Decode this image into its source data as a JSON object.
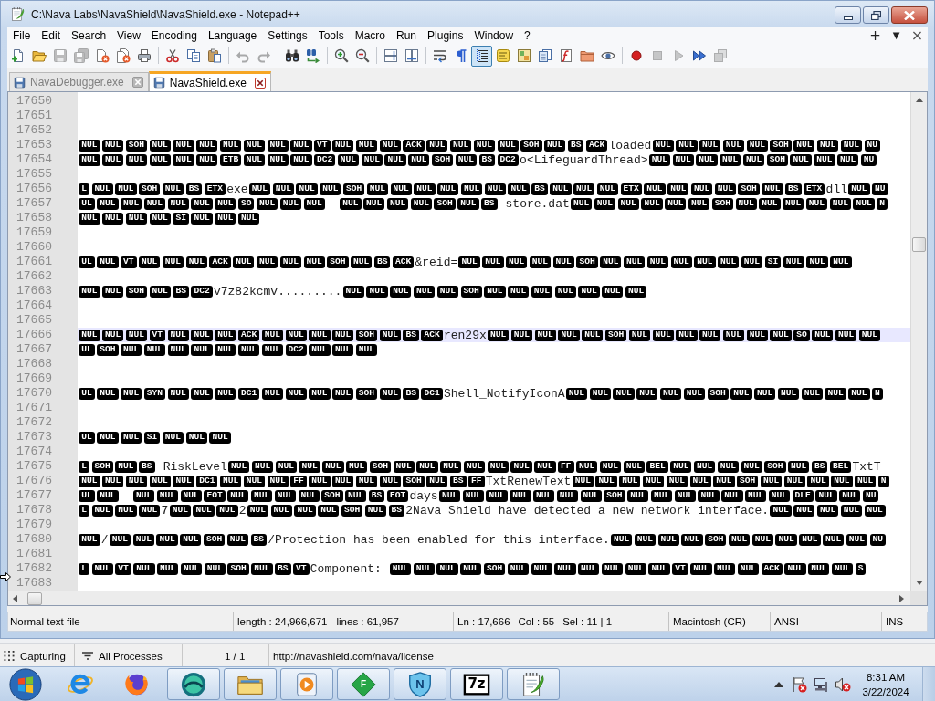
{
  "window": {
    "title": "C:\\Nava Labs\\NavaShield\\NavaShield.exe - Notepad++"
  },
  "menu": [
    "File",
    "Edit",
    "Search",
    "View",
    "Encoding",
    "Language",
    "Settings",
    "Tools",
    "Macro",
    "Run",
    "Plugins",
    "Window",
    "?"
  ],
  "menu_extras": [
    {
      "kind": "new-tab",
      "text": "+"
    },
    {
      "kind": "tab-list",
      "text": "▼"
    },
    {
      "kind": "close-tab",
      "text": "×"
    }
  ],
  "toolbar": [
    {
      "buttons": [
        {
          "kind": "new",
          "pressed": false,
          "disabled": false
        },
        {
          "kind": "open",
          "pressed": false,
          "disabled": false
        },
        {
          "kind": "save",
          "pressed": false,
          "disabled": true
        },
        {
          "kind": "save-all",
          "pressed": false,
          "disabled": true
        },
        {
          "kind": "close",
          "pressed": false,
          "disabled": false
        },
        {
          "kind": "close-all",
          "pressed": false,
          "disabled": false
        },
        {
          "kind": "print",
          "pressed": false,
          "disabled": false
        }
      ]
    },
    {
      "buttons": [
        {
          "kind": "cut",
          "pressed": false,
          "disabled": false
        },
        {
          "kind": "copy",
          "pressed": false,
          "disabled": false
        },
        {
          "kind": "paste",
          "pressed": false,
          "disabled": false
        }
      ]
    },
    {
      "buttons": [
        {
          "kind": "undo",
          "pressed": false,
          "disabled": true
        },
        {
          "kind": "redo",
          "pressed": false,
          "disabled": true
        }
      ]
    },
    {
      "buttons": [
        {
          "kind": "find",
          "pressed": false,
          "disabled": false
        },
        {
          "kind": "replace",
          "pressed": false,
          "disabled": false
        }
      ]
    },
    {
      "buttons": [
        {
          "kind": "zoom-in",
          "pressed": false,
          "disabled": false
        },
        {
          "kind": "zoom-out",
          "pressed": false,
          "disabled": false
        }
      ]
    },
    {
      "buttons": [
        {
          "kind": "sync-vertical",
          "pressed": false,
          "disabled": false
        },
        {
          "kind": "sync-horizontal",
          "pressed": false,
          "disabled": false
        }
      ]
    },
    {
      "buttons": [
        {
          "kind": "word-wrap",
          "pressed": false,
          "disabled": false
        },
        {
          "kind": "all-characters",
          "pressed": false,
          "disabled": false
        },
        {
          "kind": "indent-guide",
          "pressed": true,
          "disabled": false
        },
        {
          "kind": "language",
          "pressed": false,
          "disabled": false
        },
        {
          "kind": "document-map",
          "pressed": false,
          "disabled": false
        },
        {
          "kind": "document-list",
          "pressed": false,
          "disabled": false
        },
        {
          "kind": "function-list",
          "pressed": false,
          "disabled": false
        },
        {
          "kind": "folder-workspace",
          "pressed": false,
          "disabled": false
        },
        {
          "kind": "monitoring",
          "pressed": false,
          "disabled": false
        }
      ]
    },
    {
      "buttons": [
        {
          "kind": "record",
          "pressed": false,
          "disabled": false
        },
        {
          "kind": "stop",
          "pressed": false,
          "disabled": true
        },
        {
          "kind": "play",
          "pressed": false,
          "disabled": true
        },
        {
          "kind": "play-multiple",
          "pressed": false,
          "disabled": false
        },
        {
          "kind": "save-macro",
          "pressed": false,
          "disabled": true
        }
      ]
    }
  ],
  "tabs": [
    {
      "label": "NavaDebugger.exe",
      "selected": false
    },
    {
      "label": "NavaShield.exe",
      "selected": true
    }
  ],
  "editor": {
    "lines": [
      {
        "number": "17650",
        "current": false
      },
      {
        "number": "17651",
        "current": false
      },
      {
        "number": "17652",
        "current": false
      },
      {
        "number": "17653",
        "current": false,
        "segments": [
          {
            "kind": "ctrl",
            "codes": [
              "NUL",
              "NUL",
              "SOH",
              "NUL",
              "NUL",
              "NUL",
              "NUL",
              "NUL",
              "NUL",
              "NUL",
              "VT",
              "NUL",
              "NUL",
              "NUL",
              "ACK",
              "NUL",
              "NUL",
              "NUL",
              "NUL",
              "SOH",
              "NUL",
              "BS",
              "ACK"
            ]
          },
          {
            "kind": "text",
            "text": "loaded"
          },
          {
            "kind": "ctrl",
            "codes": [
              "NUL",
              "NUL",
              "NUL",
              "NUL",
              "NUL",
              "SOH",
              "NUL",
              "NUL",
              "NUL",
              "NU"
            ]
          }
        ]
      },
      {
        "number": "17654",
        "current": false,
        "segments": [
          {
            "kind": "ctrl",
            "codes": [
              "NUL",
              "NUL",
              "NUL",
              "NUL",
              "NUL",
              "NUL",
              "ETB",
              "NUL",
              "NUL",
              "NUL",
              "DC2",
              "NUL",
              "NUL",
              "NUL",
              "NUL",
              "SOH",
              "NUL",
              "BS",
              "DC2"
            ]
          },
          {
            "kind": "text",
            "text": "o<LifeguardThread>"
          },
          {
            "kind": "ctrl",
            "codes": [
              "NUL",
              "NUL",
              "NUL",
              "NUL",
              "NUL",
              "SOH",
              "NUL",
              "NUL",
              "NUL",
              "NU"
            ]
          }
        ]
      },
      {
        "number": "17655",
        "current": false
      },
      {
        "number": "17656",
        "current": false,
        "segments": [
          {
            "kind": "ctrl",
            "codes": [
              "L",
              "NUL",
              "NUL",
              "SOH",
              "NUL",
              "BS",
              "ETX"
            ]
          },
          {
            "kind": "text",
            "text": "exe"
          },
          {
            "kind": "ctrl",
            "codes": [
              "NUL",
              "NUL",
              "NUL",
              "NUL",
              "SOH",
              "NUL",
              "NUL",
              "NUL",
              "NUL",
              "NUL",
              "NUL",
              "NUL",
              "BS",
              "NUL",
              "NUL",
              "NUL",
              "ETX",
              "NUL",
              "NUL",
              "NUL",
              "NUL",
              "SOH",
              "NUL",
              "BS",
              "ETX"
            ]
          },
          {
            "kind": "text",
            "text": "dll"
          },
          {
            "kind": "ctrl",
            "codes": [
              "NUL",
              "NU"
            ]
          }
        ]
      },
      {
        "number": "17657",
        "current": false,
        "segments": [
          {
            "kind": "ctrl",
            "codes": [
              "UL",
              "NUL",
              "NUL",
              "NUL",
              "NUL",
              "NUL",
              "NUL",
              "SO",
              "NUL",
              "NUL",
              "NUL"
            ]
          },
          {
            "kind": "tab"
          },
          {
            "kind": "ctrl",
            "codes": [
              "NUL",
              "NUL",
              "NUL",
              "NUL",
              "SOH",
              "NUL",
              "BS"
            ]
          },
          {
            "kind": "text",
            "text": " store.dat"
          },
          {
            "kind": "ctrl",
            "codes": [
              "NUL",
              "NUL",
              "NUL",
              "NUL",
              "NUL",
              "NUL",
              "SOH",
              "NUL",
              "NUL",
              "NUL",
              "NUL",
              "NUL",
              "NUL",
              "N"
            ]
          }
        ]
      },
      {
        "number": "17658",
        "current": false,
        "segments": [
          {
            "kind": "ctrl",
            "codes": [
              "NUL",
              "NUL",
              "NUL",
              "NUL",
              "SI",
              "NUL",
              "NUL",
              "NUL"
            ]
          }
        ]
      },
      {
        "number": "17659",
        "current": false
      },
      {
        "number": "17660",
        "current": false
      },
      {
        "number": "17661",
        "current": false,
        "segments": [
          {
            "kind": "ctrl",
            "codes": [
              "UL",
              "NUL",
              "VT",
              "NUL",
              "NUL",
              "NUL",
              "ACK",
              "NUL",
              "NUL",
              "NUL",
              "NUL",
              "SOH",
              "NUL",
              "BS",
              "ACK"
            ]
          },
          {
            "kind": "text",
            "text": "&reid="
          },
          {
            "kind": "ctrl",
            "codes": [
              "NUL",
              "NUL",
              "NUL",
              "NUL",
              "NUL",
              "SOH",
              "NUL",
              "NUL",
              "NUL",
              "NUL",
              "NUL",
              "NUL",
              "NUL",
              "SI",
              "NUL",
              "NUL",
              "NUL"
            ]
          }
        ]
      },
      {
        "number": "17662",
        "current": false
      },
      {
        "number": "17663",
        "current": false,
        "segments": [
          {
            "kind": "ctrl",
            "codes": [
              "NUL",
              "NUL",
              "SOH",
              "NUL",
              "BS",
              "DC2"
            ]
          },
          {
            "kind": "text",
            "text": "v7z82kcmv........."
          },
          {
            "kind": "ctrl",
            "codes": [
              "NUL",
              "NUL",
              "NUL",
              "NUL",
              "NUL",
              "SOH",
              "NUL",
              "NUL",
              "NUL",
              "NUL",
              "NUL",
              "NUL",
              "NUL"
            ]
          }
        ]
      },
      {
        "number": "17664",
        "current": false
      },
      {
        "number": "17665",
        "current": false
      },
      {
        "number": "17666",
        "current": true,
        "segments": [
          {
            "kind": "ctrl",
            "codes": [
              "NUL",
              "NUL",
              "NUL",
              "VT",
              "NUL",
              "NUL",
              "NUL",
              "ACK",
              "NUL",
              "NUL",
              "NUL",
              "NUL",
              "SOH",
              "NUL",
              "BS",
              "ACK"
            ]
          },
          {
            "kind": "text",
            "text": "ren29x"
          },
          {
            "kind": "ctrl",
            "codes": [
              "NUL",
              "NUL",
              "NUL",
              "NUL",
              "NUL",
              "SOH",
              "NUL",
              "NUL",
              "NUL",
              "NUL",
              "NUL",
              "NUL",
              "NUL",
              "SO",
              "NUL",
              "NUL",
              "NUL"
            ]
          }
        ]
      },
      {
        "number": "17667",
        "current": false,
        "segments": [
          {
            "kind": "ctrl",
            "codes": [
              "UL",
              "SOH",
              "NUL",
              "NUL",
              "NUL",
              "NUL",
              "NUL",
              "NUL",
              "NUL",
              "DC2",
              "NUL",
              "NUL",
              "NUL"
            ]
          }
        ]
      },
      {
        "number": "17668",
        "current": false
      },
      {
        "number": "17669",
        "current": false
      },
      {
        "number": "17670",
        "current": false,
        "segments": [
          {
            "kind": "ctrl",
            "codes": [
              "UL",
              "NUL",
              "NUL",
              "SYN",
              "NUL",
              "NUL",
              "NUL",
              "DC1",
              "NUL",
              "NUL",
              "NUL",
              "NUL",
              "SOH",
              "NUL",
              "BS",
              "DC1"
            ]
          },
          {
            "kind": "text",
            "text": "Shell_NotifyIconA"
          },
          {
            "kind": "ctrl",
            "codes": [
              "NUL",
              "NUL",
              "NUL",
              "NUL",
              "NUL",
              "NUL",
              "SOH",
              "NUL",
              "NUL",
              "NUL",
              "NUL",
              "NUL",
              "NUL",
              "N"
            ]
          }
        ]
      },
      {
        "number": "17671",
        "current": false
      },
      {
        "number": "17672",
        "current": false
      },
      {
        "number": "17673",
        "current": false,
        "segments": [
          {
            "kind": "ctrl",
            "codes": [
              "UL",
              "NUL",
              "NUL",
              "SI",
              "NUL",
              "NUL",
              "NUL"
            ]
          }
        ]
      },
      {
        "number": "17674",
        "current": false
      },
      {
        "number": "17675",
        "current": false,
        "segments": [
          {
            "kind": "ctrl",
            "codes": [
              "L",
              "SOH",
              "NUL",
              "BS"
            ]
          },
          {
            "kind": "text",
            "text": " RiskLevel"
          },
          {
            "kind": "ctrl",
            "codes": [
              "NUL",
              "NUL",
              "NUL",
              "NUL",
              "NUL",
              "NUL",
              "SOH",
              "NUL",
              "NUL",
              "NUL",
              "NUL",
              "NUL",
              "NUL",
              "NUL",
              "FF",
              "NUL",
              "NUL",
              "NUL",
              "BEL",
              "NUL",
              "NUL",
              "NUL",
              "NUL",
              "SOH",
              "NUL",
              "BS",
              "BEL"
            ]
          },
          {
            "kind": "text",
            "text": "TxtT"
          }
        ]
      },
      {
        "number": "17676",
        "current": false,
        "segments": [
          {
            "kind": "ctrl",
            "codes": [
              "NUL",
              "NUL",
              "NUL",
              "NUL",
              "NUL",
              "DC1",
              "NUL",
              "NUL",
              "NUL",
              "FF",
              "NUL",
              "NUL",
              "NUL",
              "NUL",
              "SOH",
              "NUL",
              "BS",
              "FF"
            ]
          },
          {
            "kind": "text",
            "text": "TxtRenewText"
          },
          {
            "kind": "ctrl",
            "codes": [
              "NUL",
              "NUL",
              "NUL",
              "NUL",
              "NUL",
              "NUL",
              "NUL",
              "SOH",
              "NUL",
              "NUL",
              "NUL",
              "NUL",
              "NUL",
              "N"
            ]
          }
        ]
      },
      {
        "number": "17677",
        "current": false,
        "segments": [
          {
            "kind": "ctrl",
            "codes": [
              "UL",
              "NUL"
            ]
          },
          {
            "kind": "tab"
          },
          {
            "kind": "ctrl",
            "codes": [
              "NUL",
              "NUL",
              "NUL",
              "EOT",
              "NUL",
              "NUL",
              "NUL",
              "NUL",
              "SOH",
              "NUL",
              "BS",
              "EOT"
            ]
          },
          {
            "kind": "text",
            "text": "days"
          },
          {
            "kind": "ctrl",
            "codes": [
              "NUL",
              "NUL",
              "NUL",
              "NUL",
              "NUL",
              "NUL",
              "NUL",
              "SOH",
              "NUL",
              "NUL",
              "NUL",
              "NUL",
              "NUL",
              "NUL",
              "NUL",
              "DLE",
              "NUL",
              "NUL",
              "NU"
            ]
          }
        ]
      },
      {
        "number": "17678",
        "current": false,
        "segments": [
          {
            "kind": "ctrl",
            "codes": [
              "L",
              "NUL",
              "NUL",
              "NUL"
            ]
          },
          {
            "kind": "text",
            "text": "7"
          },
          {
            "kind": "ctrl",
            "codes": [
              "NUL",
              "NUL",
              "NUL"
            ]
          },
          {
            "kind": "text",
            "text": "2"
          },
          {
            "kind": "ctrl",
            "codes": [
              "NUL",
              "NUL",
              "NUL",
              "NUL",
              "SOH",
              "NUL",
              "BS"
            ]
          },
          {
            "kind": "text",
            "text": "2Nava Shield have detected a new network interface."
          },
          {
            "kind": "ctrl",
            "codes": [
              "NUL",
              "NUL",
              "NUL",
              "NUL",
              "NUL"
            ]
          }
        ]
      },
      {
        "number": "17679",
        "current": false
      },
      {
        "number": "17680",
        "current": false,
        "segments": [
          {
            "kind": "ctrl",
            "codes": [
              "NUL"
            ]
          },
          {
            "kind": "text",
            "text": "/"
          },
          {
            "kind": "ctrl",
            "codes": [
              "NUL",
              "NUL",
              "NUL",
              "NUL",
              "SOH",
              "NUL",
              "BS"
            ]
          },
          {
            "kind": "text",
            "text": "/Protection has been enabled for this interface."
          },
          {
            "kind": "ctrl",
            "codes": [
              "NUL",
              "NUL",
              "NUL",
              "NUL",
              "SOH",
              "NUL",
              "NUL",
              "NUL",
              "NUL",
              "NUL",
              "NUL",
              "NU"
            ]
          }
        ]
      },
      {
        "number": "17681",
        "current": false
      },
      {
        "number": "17682",
        "current": false,
        "segments": [
          {
            "kind": "ctrl",
            "codes": [
              "L",
              "NUL",
              "VT",
              "NUL",
              "NUL",
              "NUL",
              "NUL",
              "SOH",
              "NUL",
              "BS",
              "VT"
            ]
          },
          {
            "kind": "text",
            "text": "Component: "
          },
          {
            "kind": "ctrl",
            "codes": [
              "NUL",
              "NUL",
              "NUL",
              "NUL",
              "SOH",
              "NUL",
              "NUL",
              "NUL",
              "NUL",
              "NUL",
              "NUL",
              "NUL",
              "VT",
              "NUL",
              "NUL",
              "NUL",
              "ACK",
              "NUL",
              "NUL",
              "NUL",
              "S"
            ]
          }
        ]
      },
      {
        "number": "17683",
        "current": false
      }
    ]
  },
  "status_bar": {
    "file_type": "Normal text file",
    "length": "length : 24,966,671",
    "lines": "lines : 61,957",
    "line": "Ln : 17,666",
    "column": "Col : 55",
    "selection": "Sel : 11 | 1",
    "eol": "Macintosh (CR)",
    "encoding": "ANSI",
    "mode": "INS"
  },
  "background_status": [
    {
      "kind": "capture",
      "text": "Capturing"
    },
    {
      "kind": "filter",
      "text": "All Processes"
    },
    {
      "kind": "count",
      "text": "1 / 1"
    },
    {
      "kind": "url",
      "text": "http://navashield.com/nava/license"
    }
  ],
  "taskbar": {
    "apps": [
      {
        "kind": "ring-e",
        "running": false
      },
      {
        "kind": "fox",
        "running": false
      },
      {
        "kind": "swirl",
        "running": true
      },
      {
        "kind": "folder",
        "running": true
      },
      {
        "kind": "media",
        "running": true
      },
      {
        "kind": "diamond",
        "label": "F",
        "running": true
      },
      {
        "kind": "shield",
        "label": "N",
        "running": true
      },
      {
        "kind": "tile",
        "label": "7z",
        "running": true
      },
      {
        "kind": "notepad",
        "running": true
      }
    ],
    "clock": {
      "time": "8:31 AM",
      "date": "3/22/2024"
    }
  }
}
